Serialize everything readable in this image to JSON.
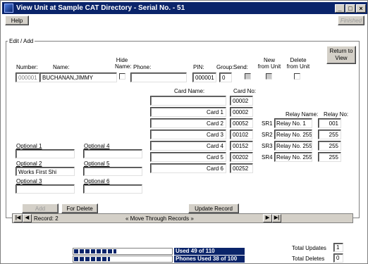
{
  "window": {
    "title": "View Unit at Sample CAT Directory - Serial No. - 51"
  },
  "toolbar": {
    "help": "Help",
    "finished": "Finished"
  },
  "group": {
    "legend": "Edit / Add"
  },
  "buttons": {
    "return_to_view": "Return to View"
  },
  "headers": {
    "number": "Number:",
    "name": "Name:",
    "hide_name": "Hide Name:",
    "phone": "Phone:",
    "pin": "PIN:",
    "group": "Group:",
    "send": "Send:",
    "new_from_unit": "New from Unit",
    "delete_from_unit": "Delete from Unit"
  },
  "record": {
    "number": "000001",
    "name": "BUCHANAN,JIMMY",
    "phone": "",
    "pin": "000001",
    "group": "0"
  },
  "cards": {
    "header_name": "Card Name:",
    "header_no": "Card No:",
    "rows": [
      {
        "name": "",
        "no": "00002"
      },
      {
        "name": "Card 1",
        "no": "00002"
      },
      {
        "name": "Card 2",
        "no": "00052"
      },
      {
        "name": "Card 3",
        "no": "00102"
      },
      {
        "name": "Card 4",
        "no": "00152"
      },
      {
        "name": "Card 5",
        "no": "00202"
      },
      {
        "name": "Card 6",
        "no": "00252"
      }
    ]
  },
  "relays": {
    "header_name": "Relay Name:",
    "header_no": "Relay No:",
    "rows": [
      {
        "code": "SR1",
        "name": "Relay No. 1",
        "no": "001"
      },
      {
        "code": "SR2",
        "name": "Relay No. 255",
        "no": "255"
      },
      {
        "code": "SR3",
        "name": "Relay No. 255",
        "no": "255"
      },
      {
        "code": "SR4",
        "name": "Relay No. 255",
        "no": "255"
      }
    ]
  },
  "optionals": [
    {
      "label": "Optional 1",
      "value": ""
    },
    {
      "label": "Optional 2",
      "value": "Works First Shi"
    },
    {
      "label": "Optional 3",
      "value": ""
    },
    {
      "label": "Optional 4",
      "value": ""
    },
    {
      "label": "Optional 5",
      "value": ""
    },
    {
      "label": "Optional 6",
      "value": ""
    }
  ],
  "actions": {
    "add": "Add",
    "for_delete": "For Delete",
    "update_record": "Update Record"
  },
  "nav": {
    "record_label": "Record: 2",
    "move_text": "« Move Through Records »"
  },
  "status": {
    "used_text": "Used 49 of 110",
    "used_fraction": 0.445,
    "phones_text": "Phones Used 38 of 100",
    "phones_fraction": 0.38,
    "total_updates_label": "Total Updates",
    "total_updates": "1",
    "total_deletes_label": "Total Deletes",
    "total_deletes": "0"
  }
}
